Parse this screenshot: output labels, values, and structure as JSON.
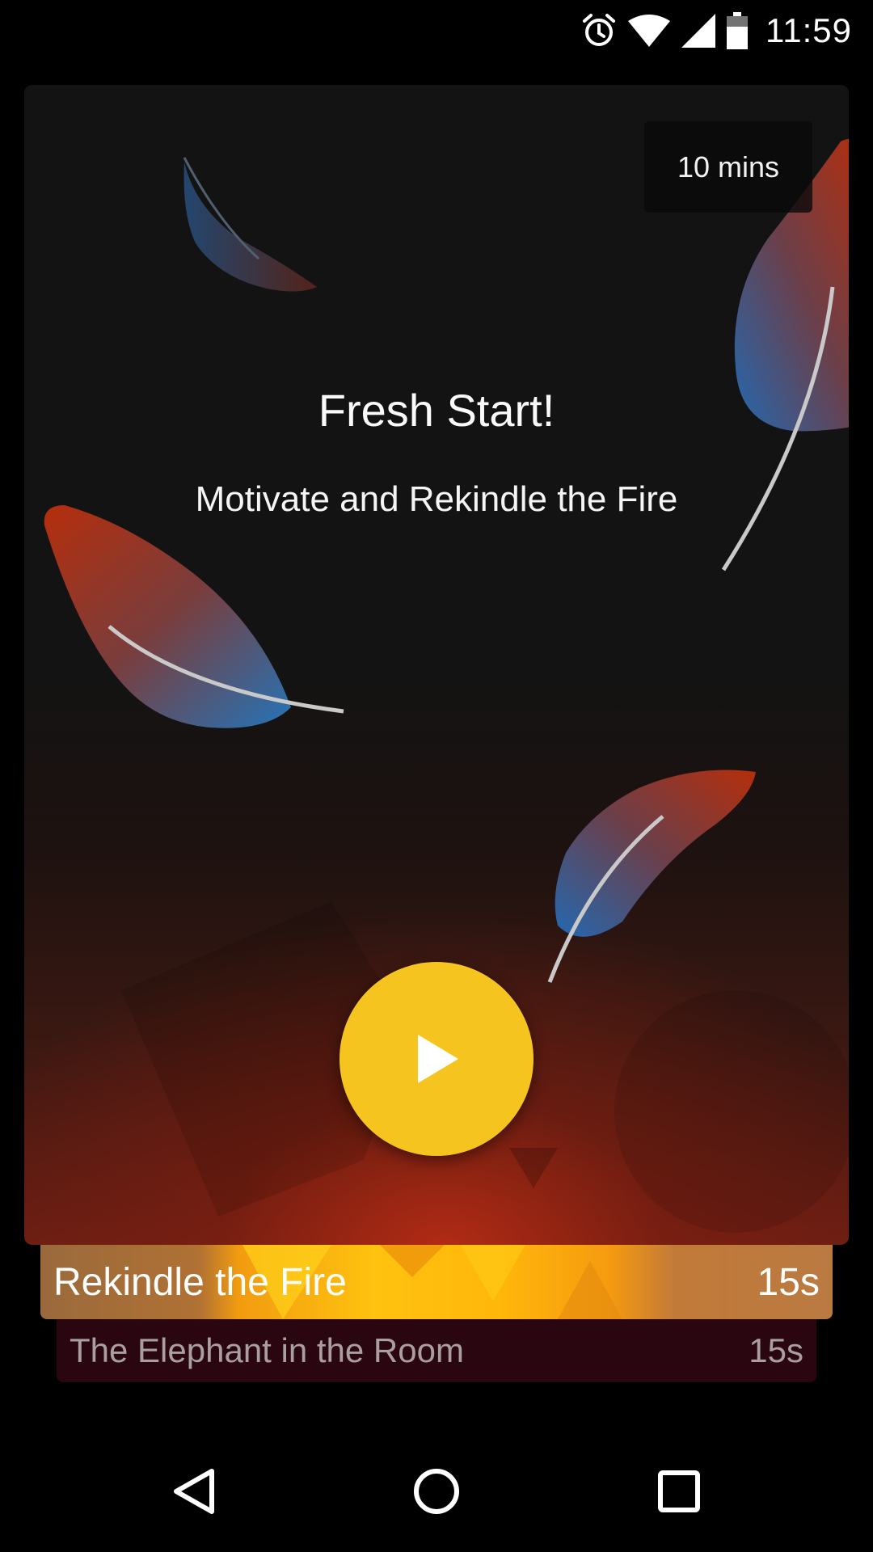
{
  "status_bar": {
    "time": "11:59",
    "icons": [
      "alarm-icon",
      "wifi-icon",
      "signal-icon",
      "battery-icon"
    ]
  },
  "card": {
    "duration": "10 mins",
    "title": "Fresh Start!",
    "subtitle": "Motivate and Rekindle the Fire",
    "play_icon": "play-icon",
    "accent_color": "#f6c41f"
  },
  "tracks": [
    {
      "name": "Rekindle the Fire",
      "duration": "15s"
    },
    {
      "name": "The Elephant in the Room",
      "duration": "15s"
    }
  ],
  "nav_bar": {
    "icons": [
      "back-icon",
      "home-icon",
      "recent-apps-icon"
    ]
  }
}
